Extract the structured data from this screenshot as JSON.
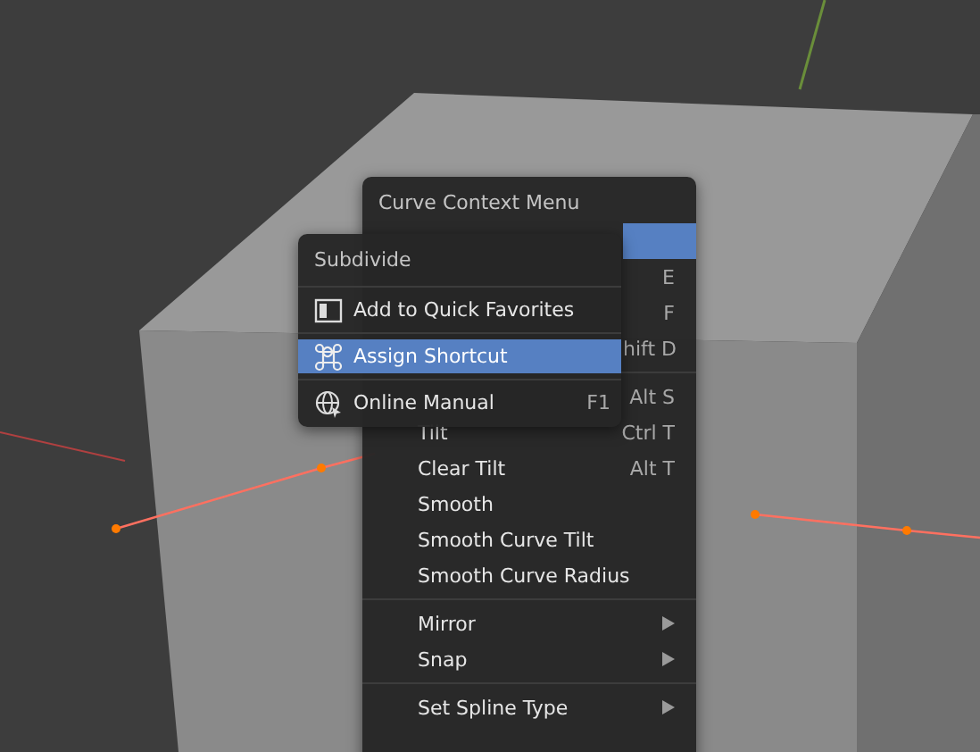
{
  "context_menu": {
    "title": "Curve Context Menu",
    "sections": [
      [
        {
          "selected": true,
          "submenu": false
        },
        {
          "shortcut": "E",
          "selected": false,
          "submenu": false
        },
        {
          "shortcut": "F",
          "selected": false,
          "submenu": false
        },
        {
          "shortcut": "hift D",
          "selected": false,
          "submenu": false
        }
      ],
      [
        {
          "shortcut": "Alt S",
          "selected": false,
          "submenu": false
        },
        {
          "label": "Tilt",
          "shortcut": "Ctrl T",
          "selected": false,
          "submenu": false
        },
        {
          "label": "Clear Tilt",
          "shortcut": "Alt T",
          "selected": false,
          "submenu": false
        },
        {
          "label": "Smooth",
          "selected": false,
          "submenu": false
        },
        {
          "label": "Smooth Curve Tilt",
          "selected": false,
          "submenu": false
        },
        {
          "label": "Smooth Curve Radius",
          "selected": false,
          "submenu": false
        }
      ],
      [
        {
          "label": "Mirror",
          "selected": false,
          "submenu": true
        },
        {
          "label": "Snap",
          "selected": false,
          "submenu": true
        }
      ],
      [
        {
          "label": "Set Spline Type",
          "selected": false,
          "submenu": true
        }
      ]
    ]
  },
  "item_popup": {
    "title": "Subdivide",
    "sections": [
      [
        {
          "kind": "favorites",
          "label": "Add to Quick Favorites",
          "selected": false
        }
      ],
      [
        {
          "kind": "shortcut",
          "label": "Assign Shortcut",
          "selected": true
        }
      ],
      [
        {
          "kind": "manual",
          "label": "Online Manual",
          "shortcut": "F1",
          "selected": false
        }
      ]
    ]
  }
}
